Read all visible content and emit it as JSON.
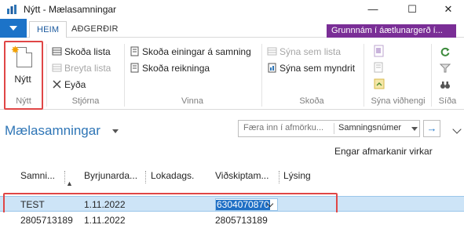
{
  "window": {
    "title": "Nýtt - Mælasamningar",
    "min_glyph": "—",
    "max_glyph": "☐",
    "close_glyph": "✕"
  },
  "tabs": {
    "home": "HEIM",
    "actions": "AÐGERÐIR",
    "badge": "Grunnnám í áætlunargerð í..."
  },
  "ribbon": {
    "new_label": "Nýtt",
    "group_new": "Nýtt",
    "manage": {
      "view_list": "Skoða lista",
      "edit_list": "Breyta lista",
      "delete": "Eyða",
      "group": "Stjórna"
    },
    "process": {
      "view_units": "Skoða einingar á samning",
      "view_invoice": "Skoða reikninga",
      "group": "Vinna"
    },
    "view": {
      "show_list": "Sýna sem lista",
      "show_chart": "Sýna sem myndrit",
      "group": "Skoða"
    },
    "attachments_group": "Sýna viðhengi",
    "page_group": "Síða"
  },
  "page": {
    "title": "Mælasamningar",
    "filter_placeholder": "Færa inn í afmörku...",
    "filter_field": "Samningsnúmer",
    "go_glyph": "→",
    "filter_status": "Engar afmarkanir virkar"
  },
  "grid": {
    "headers": [
      "Samni...",
      "Byrjunarda...",
      "Lokadags.",
      "Viðskiptam...",
      "Lýsing"
    ],
    "rows": [
      [
        "TEST",
        "1.11.2022",
        "",
        "6304070870",
        ""
      ],
      [
        "2805713189",
        "1.11.2022",
        "",
        "2805713189",
        ""
      ]
    ]
  },
  "colors": {
    "accent": "#1c73c8",
    "title_blue": "#2e75b6",
    "badge_purple": "#7a2e96",
    "highlight_red": "#e04646",
    "selection": "#cde4f7"
  }
}
